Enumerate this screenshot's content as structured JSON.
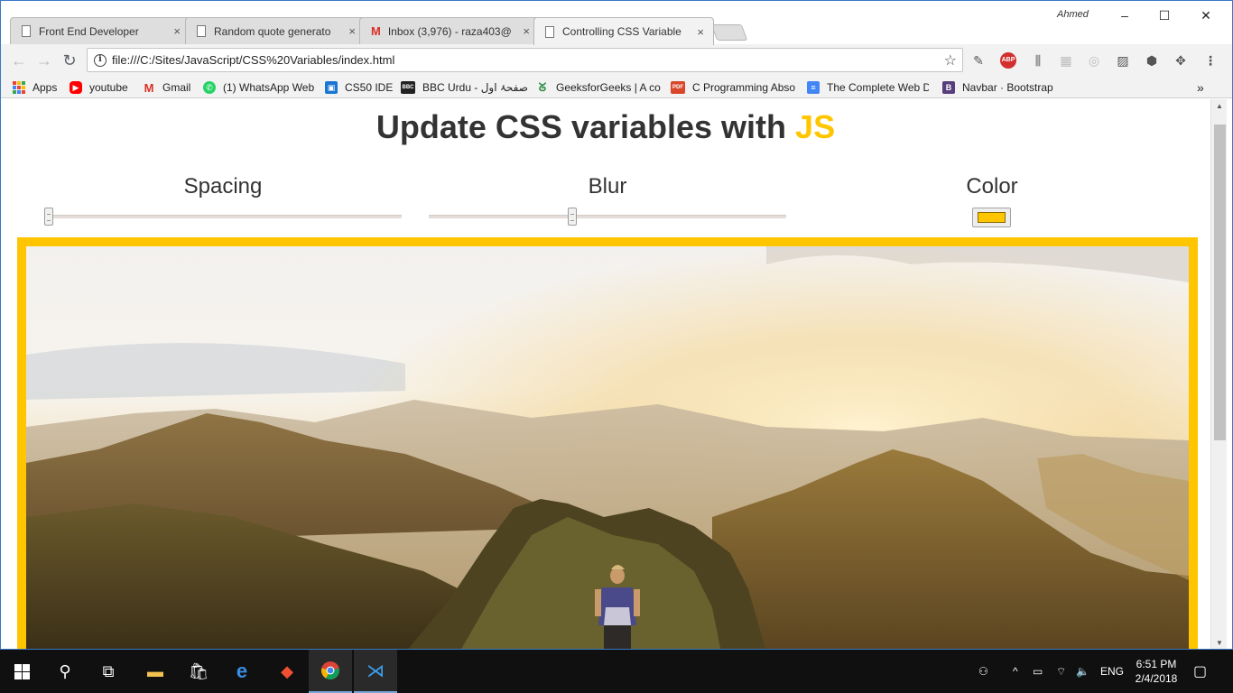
{
  "browser": {
    "tabs": [
      {
        "label": "Front End Developer",
        "icon": "document-icon",
        "active": false
      },
      {
        "label": "Random quote generato",
        "icon": "document-icon",
        "active": false
      },
      {
        "label": "Inbox (3,976) - raza403@",
        "icon": "gmail-icon",
        "active": false
      },
      {
        "label": "Controlling CSS Variable",
        "icon": "document-icon",
        "active": true
      }
    ],
    "tab_close_glyph": "×",
    "profile_name": "Ahmed",
    "window_controls": {
      "minimize": "–",
      "maximize": "☐",
      "close": "✕"
    },
    "nav": {
      "back": "←",
      "forward": "→",
      "reload": "↻"
    },
    "address": "file:///C:/Sites/JavaScript/CSS%20Variables/index.html",
    "bookmarks": [
      {
        "label": "Apps",
        "icon": "apps-grid-icon"
      },
      {
        "label": "youtube",
        "icon": "youtube-icon",
        "color": "#ff0000"
      },
      {
        "label": "Gmail",
        "icon": "gmail-icon",
        "color": "#d93025"
      },
      {
        "label": "(1) WhatsApp Web",
        "icon": "whatsapp-icon",
        "color": "#25d366"
      },
      {
        "label": "CS50 IDE",
        "icon": "cs50-icon",
        "color": "#1976d2"
      },
      {
        "label": "BBC Urdu - صفحۂ اول",
        "icon": "bbc-icon",
        "color": "#222222"
      },
      {
        "label": "GeeksforGeeks | A co",
        "icon": "geeksforgeeks-icon",
        "color": "#2f8d46"
      },
      {
        "label": "C Programming Abso",
        "icon": "pdf-icon",
        "color": "#d9472b"
      },
      {
        "label": "The Complete Web D",
        "icon": "google-docs-icon",
        "color": "#4285f4"
      },
      {
        "label": "Navbar · Bootstrap",
        "icon": "bootstrap-icon",
        "color": "#563d7c"
      }
    ],
    "bookmarks_overflow": "»"
  },
  "page": {
    "title_prefix": "Update CSS variables with",
    "title_highlight": "JS",
    "controls": {
      "spacing": {
        "label": "Spacing",
        "value_fraction": 0.0
      },
      "blur": {
        "label": "Blur",
        "value_fraction": 0.4
      },
      "color": {
        "label": "Color",
        "value": "#ffc600"
      }
    },
    "photo": "mountain-hiker-sunset-image"
  },
  "colors": {
    "accent": "#ffc600",
    "text": "#333333"
  },
  "taskbar": {
    "language": "ENG",
    "time": "6:51 PM",
    "date": "2/4/2018"
  }
}
